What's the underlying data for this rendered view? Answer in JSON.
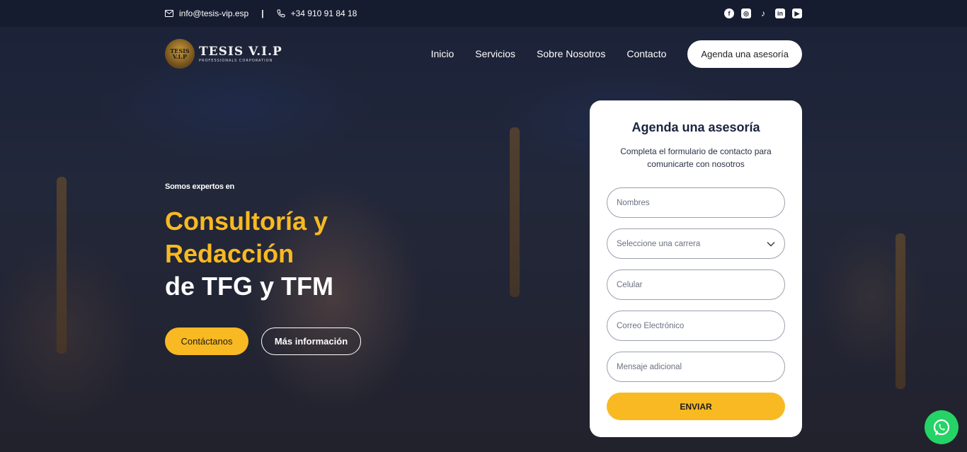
{
  "topbar": {
    "email": "info@tesis-vip.esp",
    "separator": "|",
    "phone": "+34 910 91 84 18",
    "socials": [
      "facebook",
      "instagram",
      "tiktok",
      "linkedin",
      "youtube"
    ]
  },
  "logo": {
    "badge_text": "TESIS V.I.P",
    "title": "TESIS V.I.P",
    "subtitle": "PROFESSIONALS CORPORATION"
  },
  "nav": {
    "items": [
      "Inicio",
      "Servicios",
      "Sobre Nosotros",
      "Contacto"
    ],
    "cta": "Agenda una asesoría"
  },
  "hero": {
    "kicker": "Somos expertos en",
    "headline_line1": "Consultoría y",
    "headline_line2": "Redacción",
    "headline_line3": "de TFG y TFM",
    "primary_button": "Contáctanos",
    "secondary_button": "Más información"
  },
  "form": {
    "title": "Agenda una asesoría",
    "description": "Completa el formulario de contacto para comunicarte con nosotros",
    "fields": [
      {
        "placeholder": "Nombres"
      },
      {
        "placeholder": "Seleccione una carrera"
      },
      {
        "placeholder": "Celular"
      },
      {
        "placeholder": "Correo Electrónico"
      },
      {
        "placeholder": "Mensaje adicional"
      }
    ],
    "submit": "ENVIAR"
  },
  "colors": {
    "accent": "#f8b922",
    "whatsapp": "#25d366",
    "topbar": "#161c30"
  }
}
